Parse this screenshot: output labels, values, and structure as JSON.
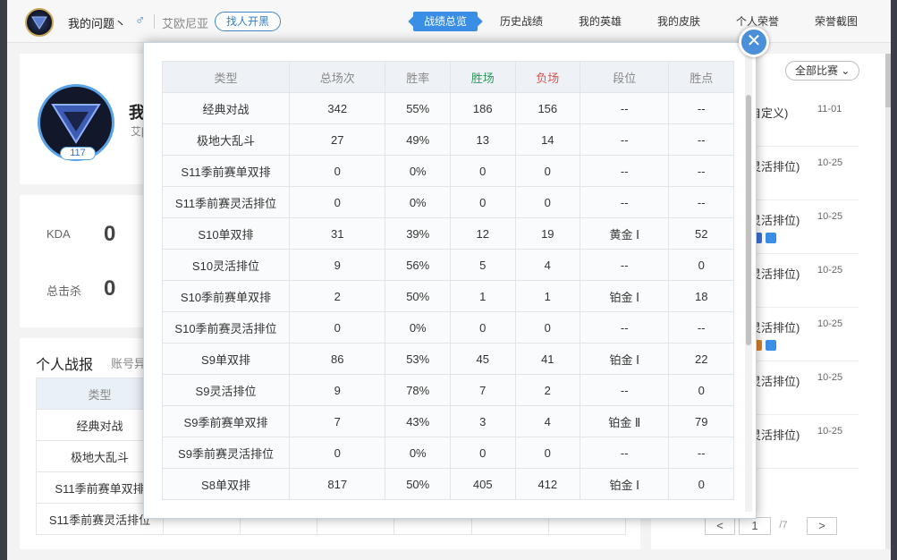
{
  "header": {
    "summoner_name": "我的问题丶",
    "gender_symbol": "♂",
    "server": "艾欧尼亚",
    "find_button": "找人开黑",
    "nav": [
      "战绩总览",
      "历史战绩",
      "我的英雄",
      "我的皮肤",
      "个人荣誉",
      "荣誉截图"
    ]
  },
  "profile": {
    "name_partial": "我",
    "server_partial": "艾[",
    "level": "117"
  },
  "stats": {
    "kda_label": "KDA",
    "kda_value": "0",
    "kills_label": "总击杀",
    "kills_value": "0"
  },
  "personal_report": {
    "title": "个人战报",
    "subtitle": "账号异",
    "header_type": "类型",
    "rows": [
      "经典对战",
      "极地大乱斗",
      "S11季前赛单双排",
      "S11季前赛灵活排位"
    ]
  },
  "match_list": {
    "filter": "全部比赛",
    "items": [
      {
        "title": "自定义)",
        "date": "11-01"
      },
      {
        "title": "灵活排位)",
        "date": "10-25"
      },
      {
        "title": "灵活排位)",
        "date": "10-25"
      },
      {
        "title": "灵活排位)",
        "date": "10-25"
      },
      {
        "title": "灵活排位)",
        "date": "10-25"
      },
      {
        "title": "灵活排位)",
        "date": "10-25"
      },
      {
        "title": "灵活排位)",
        "date": "10-25"
      }
    ],
    "pager": {
      "prev": "<",
      "current": "1",
      "total": "/7",
      "next": ">"
    }
  },
  "modal": {
    "close": "✕",
    "headers": [
      "类型",
      "总场次",
      "胜率",
      "胜场",
      "负场",
      "段位",
      "胜点"
    ],
    "rows": [
      [
        "经典对战",
        "342",
        "55%",
        "186",
        "156",
        "--",
        "--"
      ],
      [
        "极地大乱斗",
        "27",
        "49%",
        "13",
        "14",
        "--",
        "--"
      ],
      [
        "S11季前赛单双排",
        "0",
        "0%",
        "0",
        "0",
        "--",
        "--"
      ],
      [
        "S11季前赛灵活排位",
        "0",
        "0%",
        "0",
        "0",
        "--",
        "--"
      ],
      [
        "S10单双排",
        "31",
        "39%",
        "12",
        "19",
        "黄金 Ⅰ",
        "52"
      ],
      [
        "S10灵活排位",
        "9",
        "56%",
        "5",
        "4",
        "--",
        "0"
      ],
      [
        "S10季前赛单双排",
        "2",
        "50%",
        "1",
        "1",
        "铂金 Ⅰ",
        "18"
      ],
      [
        "S10季前赛灵活排位",
        "0",
        "0%",
        "0",
        "0",
        "--",
        "--"
      ],
      [
        "S9单双排",
        "86",
        "53%",
        "45",
        "41",
        "铂金 Ⅰ",
        "22"
      ],
      [
        "S9灵活排位",
        "9",
        "78%",
        "7",
        "2",
        "--",
        "0"
      ],
      [
        "S9季前赛单双排",
        "7",
        "43%",
        "3",
        "4",
        "铂金 Ⅱ",
        "79"
      ],
      [
        "S9季前赛灵活排位",
        "0",
        "0%",
        "0",
        "0",
        "--",
        "--"
      ],
      [
        "S8单双排",
        "817",
        "50%",
        "405",
        "412",
        "铂金 Ⅰ",
        "0"
      ]
    ]
  }
}
